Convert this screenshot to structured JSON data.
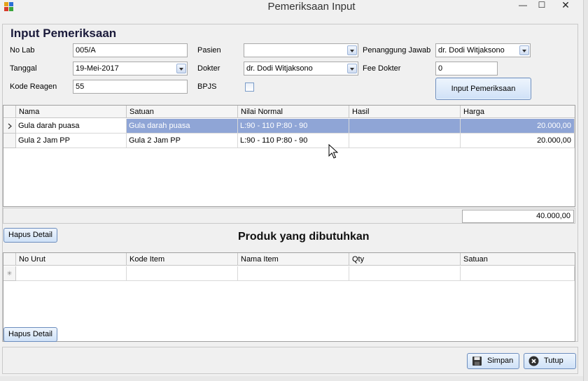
{
  "window": {
    "title": "Pemeriksaan Input",
    "min_glyph": "—",
    "max_glyph": "☐",
    "close_glyph": "✕"
  },
  "form": {
    "heading": "Input Pemeriksaan",
    "no_lab": {
      "label": "No Lab",
      "value": "005/A"
    },
    "tanggal": {
      "label": "Tanggal",
      "value": "19-Mei-2017"
    },
    "kode_reagen": {
      "label": "Kode Reagen",
      "value": "55"
    },
    "pasien": {
      "label": "Pasien",
      "value": ""
    },
    "dokter": {
      "label": "Dokter",
      "value": "dr. Dodi Witjaksono"
    },
    "bpjs": {
      "label": "BPJS",
      "checked": false
    },
    "penanggung_jawab": {
      "label": "Penanggung Jawab",
      "value": "dr. Dodi Witjaksono"
    },
    "fee_dokter": {
      "label": "Fee Dokter",
      "value": "0"
    },
    "input_button": "Input Pemeriksaan"
  },
  "exam_grid": {
    "columns": [
      "Nama",
      "Satuan",
      "Nilai Normal",
      "Hasil",
      "Harga"
    ],
    "rows": [
      {
        "nama": "Gula darah puasa",
        "satuan": "Gula darah puasa",
        "nilai_normal": "L:90 - 110 P:80 - 90",
        "hasil": "",
        "harga": "20.000,00",
        "selected": true
      },
      {
        "nama": "Gula 2 Jam PP",
        "satuan": "Gula 2 Jam PP",
        "nilai_normal": "L:90 - 110 P:80 - 90",
        "hasil": "",
        "harga": "20.000,00",
        "selected": false
      }
    ],
    "total": "40.000,00",
    "delete_button": "Hapus Detail"
  },
  "produk": {
    "heading": "Produk yang dibutuhkan",
    "columns": [
      "No Urut",
      "Kode Item",
      "Nama Item",
      "Qty",
      "Satuan"
    ],
    "new_row_glyph": "✳",
    "delete_button": "Hapus Detail"
  },
  "footer": {
    "save_button": "Simpan",
    "close_button": "Tutup"
  }
}
